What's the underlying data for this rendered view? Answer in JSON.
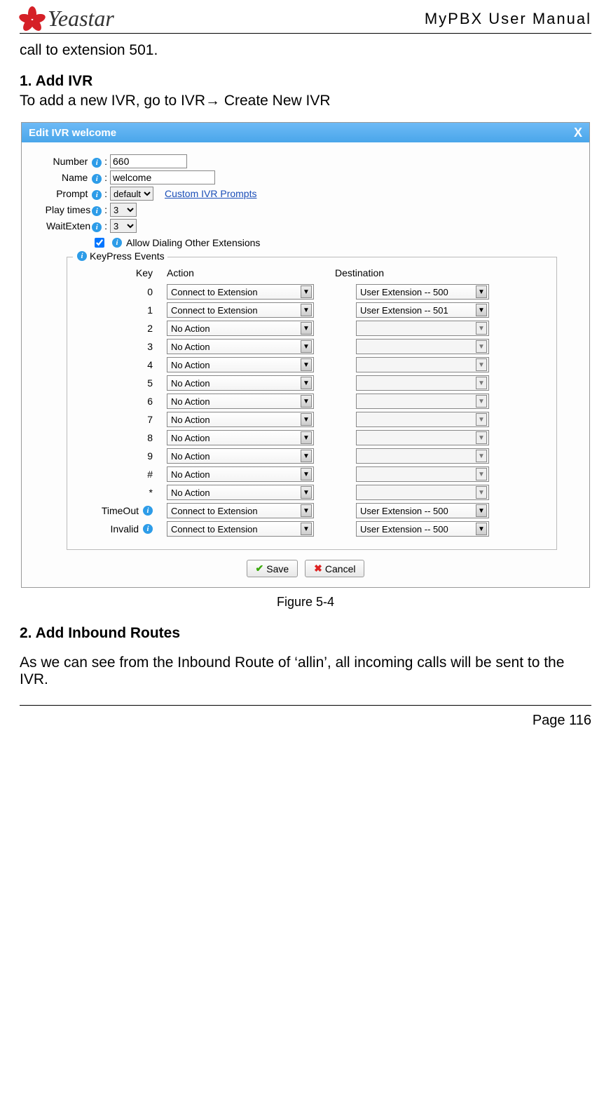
{
  "header": {
    "brand_name": "Yeastar",
    "doc_title": "MyPBX  User  Manual"
  },
  "text": {
    "pre_line": "call to extension 501.",
    "h1": "1. Add IVR",
    "h1_body": "To add a new IVR, go to IVR→ Create New IVR",
    "fig_caption": "Figure 5-4",
    "h2": "2. Add Inbound Routes",
    "h2_body": "As we can see from the Inbound Route of ‘allin’, all incoming calls will be sent to the IVR.",
    "page_no": "Page 116"
  },
  "dialog": {
    "title": "Edit IVR welcome",
    "close": "X",
    "labels": {
      "number": "Number",
      "name": "Name",
      "prompt": "Prompt",
      "playtimes": "Play times",
      "waitexten": "WaitExten",
      "allow_dial": "Allow Dialing Other Extensions",
      "keypress_legend": "KeyPress Events",
      "col_key": "Key",
      "col_action": "Action",
      "col_dest": "Destination",
      "custom_link": "Custom IVR Prompts",
      "save": "Save",
      "cancel": "Cancel"
    },
    "values": {
      "number": "660",
      "name": "welcome",
      "prompt": "default",
      "playtimes": "3",
      "waitexten": "3",
      "allow_dial_checked": true
    },
    "rows": [
      {
        "key": "0",
        "action": "Connect to Extension",
        "dest": "User Extension -- 500",
        "enabled": true,
        "info": false
      },
      {
        "key": "1",
        "action": "Connect to Extension",
        "dest": "User Extension -- 501",
        "enabled": true,
        "info": false
      },
      {
        "key": "2",
        "action": "No Action",
        "dest": "",
        "enabled": false,
        "info": false
      },
      {
        "key": "3",
        "action": "No Action",
        "dest": "",
        "enabled": false,
        "info": false
      },
      {
        "key": "4",
        "action": "No Action",
        "dest": "",
        "enabled": false,
        "info": false
      },
      {
        "key": "5",
        "action": "No Action",
        "dest": "",
        "enabled": false,
        "info": false
      },
      {
        "key": "6",
        "action": "No Action",
        "dest": "",
        "enabled": false,
        "info": false
      },
      {
        "key": "7",
        "action": "No Action",
        "dest": "",
        "enabled": false,
        "info": false
      },
      {
        "key": "8",
        "action": "No Action",
        "dest": "",
        "enabled": false,
        "info": false
      },
      {
        "key": "9",
        "action": "No Action",
        "dest": "",
        "enabled": false,
        "info": false
      },
      {
        "key": "#",
        "action": "No Action",
        "dest": "",
        "enabled": false,
        "info": false
      },
      {
        "key": "*",
        "action": "No Action",
        "dest": "",
        "enabled": false,
        "info": false
      },
      {
        "key": "TimeOut",
        "action": "Connect to Extension",
        "dest": "User Extension -- 500",
        "enabled": true,
        "info": true
      },
      {
        "key": "Invalid",
        "action": "Connect to Extension",
        "dest": "User Extension -- 500",
        "enabled": true,
        "info": true
      }
    ]
  }
}
